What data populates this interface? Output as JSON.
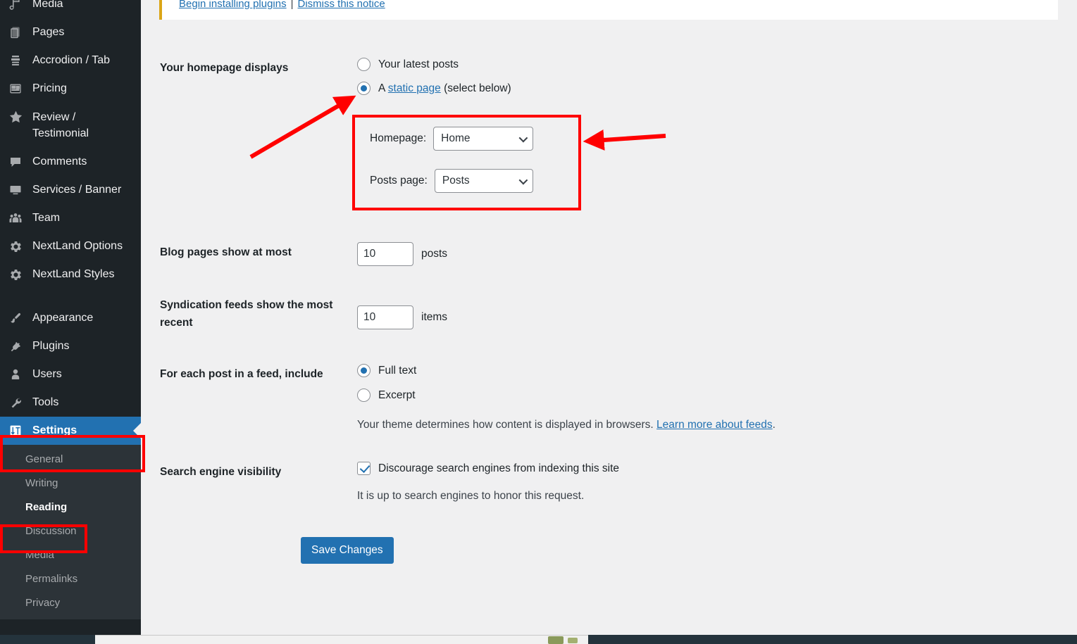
{
  "app": {
    "name": "WordPress Admin — Reading Settings",
    "accent_color": "#2271b1",
    "sidebar_bg": "#1d2327",
    "submenu_bg": "#2c3338",
    "content_bg": "#f0f0f1",
    "annotation_color": "#ff0000",
    "notice_border_color": "#dba617"
  },
  "notice": {
    "begin_installing_label": "Begin installing plugins",
    "separator": "|",
    "dismiss_label": "Dismiss this notice"
  },
  "sidebar": {
    "items": [
      {
        "label": "Media",
        "icon": "media-icon",
        "current": false,
        "clipped_top": true
      },
      {
        "label": "Pages",
        "icon": "pages-icon",
        "current": false
      },
      {
        "label": "Accrodion / Tab",
        "icon": "accordion-icon",
        "current": false
      },
      {
        "label": "Pricing",
        "icon": "pricing-icon",
        "current": false
      },
      {
        "label": "Review / Testimonial",
        "icon": "star-icon",
        "current": false,
        "two_line": true
      },
      {
        "label": "Comments",
        "icon": "comments-icon",
        "current": false
      },
      {
        "label": "Services / Banner",
        "icon": "monitor-icon",
        "current": false
      },
      {
        "label": "Team",
        "icon": "team-icon",
        "current": false
      },
      {
        "label": "NextLand Options",
        "icon": "gear-icon",
        "current": false
      },
      {
        "label": "NextLand Styles",
        "icon": "gear-icon",
        "current": false
      },
      {
        "label": "Appearance",
        "icon": "appearance-brush-icon",
        "current": false
      },
      {
        "label": "Plugins",
        "icon": "plugins-plug-icon",
        "current": false
      },
      {
        "label": "Users",
        "icon": "users-icon",
        "current": false
      },
      {
        "label": "Tools",
        "icon": "tools-wrench-icon",
        "current": false
      },
      {
        "label": "Settings",
        "icon": "settings-sliders-icon",
        "current": true
      }
    ],
    "submenu": [
      {
        "label": "General",
        "current": false
      },
      {
        "label": "Writing",
        "current": false
      },
      {
        "label": "Reading",
        "current": true
      },
      {
        "label": "Discussion",
        "current": false
      },
      {
        "label": "Media",
        "current": false
      },
      {
        "label": "Permalinks",
        "current": false
      },
      {
        "label": "Privacy",
        "current": false
      }
    ]
  },
  "form": {
    "homepage_displays": {
      "label": "Your homepage displays",
      "option_latest_posts": "Your latest posts",
      "option_static_prefix": "A ",
      "option_static_link": "static page",
      "option_static_suffix": " (select below)",
      "selected": "static_page",
      "homepage_label": "Homepage:",
      "homepage_value": "Home",
      "homepage_options": [
        "Home"
      ],
      "posts_page_label": "Posts page:",
      "posts_page_value": "Posts",
      "posts_page_options": [
        "Posts"
      ]
    },
    "blog_pages": {
      "label": "Blog pages show at most",
      "value": "10",
      "suffix": "posts"
    },
    "syndication_feeds": {
      "label": "Syndication feeds show the most recent",
      "value": "10",
      "suffix": "items"
    },
    "feed_include": {
      "label": "For each post in a feed, include",
      "option_full_text": "Full text",
      "option_excerpt": "Excerpt",
      "selected": "full_text",
      "helper_text": "Your theme determines how content is displayed in browsers. ",
      "helper_link": "Learn more about feeds",
      "helper_suffix": "."
    },
    "search_visibility": {
      "label": "Search engine visibility",
      "checkbox_label": "Discourage search engines from indexing this site",
      "checked": true,
      "helper_text": "It is up to search engines to honor this request."
    },
    "save_button": "Save Changes"
  },
  "annotations": {
    "box_static_page": "red-highlight-box-around-static-page-selectors",
    "box_settings_menu": "red-highlight-box-around-settings-menu-item",
    "box_reading_submenu": "red-highlight-box-around-reading-submenu-item",
    "arrow_to_radio": "red-arrow-pointing-to-static-page-radio",
    "arrow_to_box": "red-arrow-pointing-to-static-page-box"
  }
}
